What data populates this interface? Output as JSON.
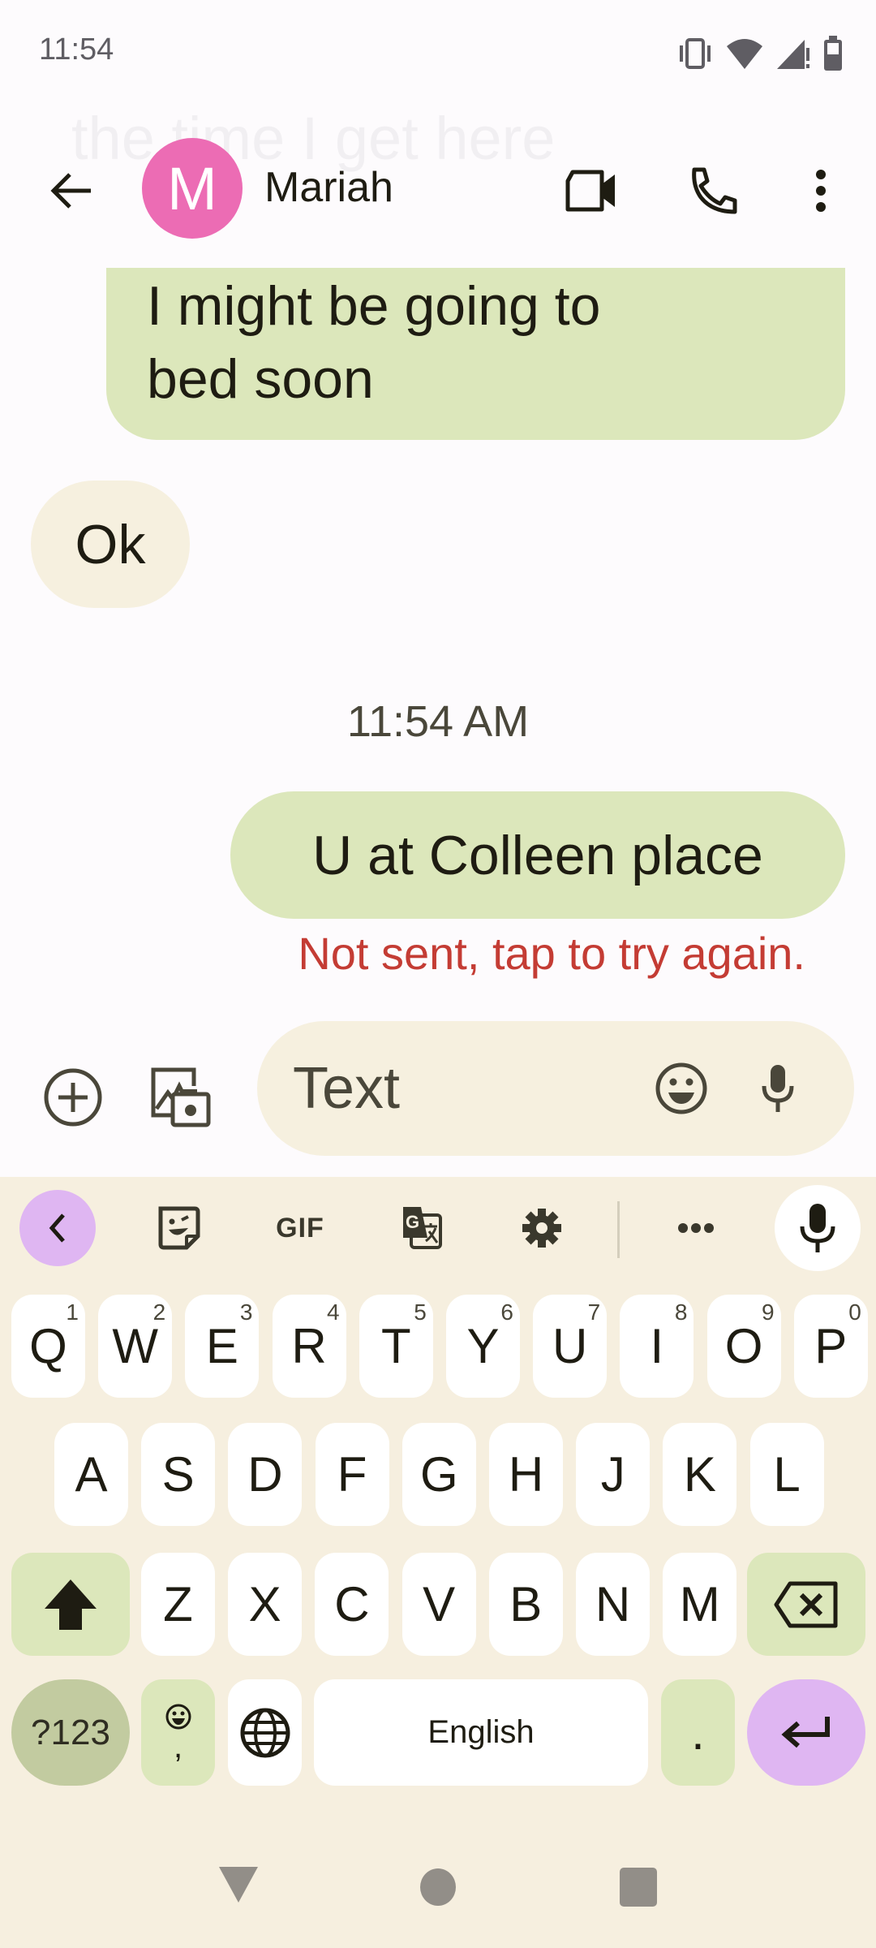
{
  "status_bar": {
    "time": "11:54",
    "icons": [
      "vibrate-icon",
      "wifi-icon",
      "signal-no-service-icon",
      "battery-icon"
    ]
  },
  "scroll_fade_text": "the time I get here",
  "header": {
    "back_icon": "arrow-back-icon",
    "avatar_initial": "M",
    "avatar_color": "#ec6cb4",
    "contact_name": "Mariah",
    "actions": [
      "video-call-icon",
      "phone-icon",
      "more-vert-icon"
    ]
  },
  "messages": [
    {
      "direction": "outgoing",
      "lines": [
        "I might be going to",
        "bed soon"
      ]
    },
    {
      "direction": "incoming",
      "text": "Ok"
    },
    {
      "type": "timestamp",
      "text": "11:54 AM"
    },
    {
      "direction": "outgoing",
      "text": "U at Colleen place",
      "status": "Not sent, tap to try again."
    }
  ],
  "compose": {
    "attach_icon": "add-circle-icon",
    "gallery_icon": "gallery-camera-icon",
    "placeholder": "Text",
    "value": "",
    "emoji_icon": "emoji-icon",
    "voice_icon": "mic-icon"
  },
  "keyboard": {
    "toolbar": {
      "collapse_icon": "chevron-left-icon",
      "sticker_icon": "sticker-icon",
      "gif_label": "GIF",
      "translate_icon": "translate-icon",
      "settings_icon": "gear-icon",
      "more_label": "•••",
      "mic_icon": "mic-icon"
    },
    "row1": [
      {
        "label": "Q",
        "hint": "1"
      },
      {
        "label": "W",
        "hint": "2"
      },
      {
        "label": "E",
        "hint": "3"
      },
      {
        "label": "R",
        "hint": "4"
      },
      {
        "label": "T",
        "hint": "5"
      },
      {
        "label": "Y",
        "hint": "6"
      },
      {
        "label": "U",
        "hint": "7"
      },
      {
        "label": "I",
        "hint": "8"
      },
      {
        "label": "O",
        "hint": "9"
      },
      {
        "label": "P",
        "hint": "0"
      }
    ],
    "row2": [
      "A",
      "S",
      "D",
      "F",
      "G",
      "H",
      "J",
      "K",
      "L"
    ],
    "row3": [
      "Z",
      "X",
      "C",
      "V",
      "B",
      "N",
      "M"
    ],
    "symbols_label": "?123",
    "comma_label": ",",
    "space_label": "English",
    "period_label": ".",
    "colors": {
      "background": "#f6efdf",
      "key": "#ffffff",
      "modifier": "#dce7bb",
      "accent": "#dfb6f2"
    }
  },
  "nav_bar": [
    "nav-back",
    "nav-home",
    "nav-recents"
  ],
  "colors": {
    "outgoing_bubble": "#dce7bb",
    "incoming_bubble": "#f6f0df",
    "error_text": "#c43c34"
  }
}
